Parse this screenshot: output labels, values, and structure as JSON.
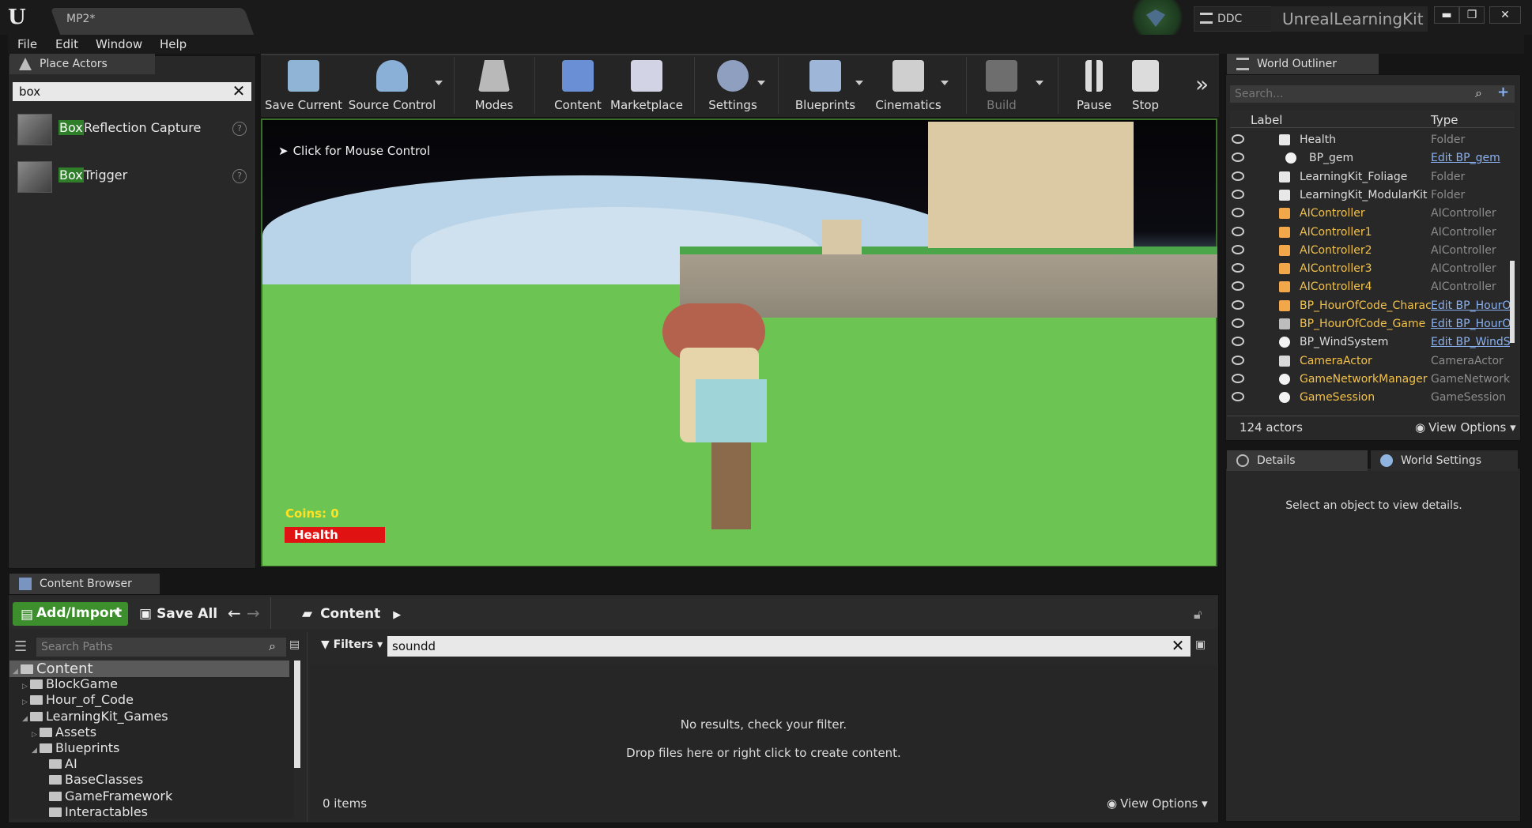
{
  "window": {
    "document_tab": "MP2*",
    "ddc_label": "DDC",
    "project_name": "UnrealLearningKit",
    "min_glyph": "▬",
    "restore_glyph": "❐",
    "close_glyph": "✕"
  },
  "menu": [
    "File",
    "Edit",
    "Window",
    "Help"
  ],
  "place_actors": {
    "tab": "Place Actors",
    "search_value": "box",
    "items": [
      {
        "highlight": "Box",
        "rest": " Reflection Capture"
      },
      {
        "highlight": "Box",
        "rest": " Trigger"
      }
    ]
  },
  "toolbar": {
    "buttons": [
      "Save Current",
      "Source Control",
      "Modes",
      "Content",
      "Marketplace",
      "Settings",
      "Blueprints",
      "Cinematics",
      "Build",
      "Pause",
      "Stop"
    ],
    "more_glyph": "»"
  },
  "viewport": {
    "hint": "Click for Mouse Control",
    "coins": "Coins: 0",
    "health": "Health"
  },
  "world_outliner": {
    "tab": "World Outliner",
    "search_placeholder": "Search...",
    "col_label": "Label",
    "col_type": "Type",
    "rows": [
      {
        "name": "Health",
        "type": "Folder",
        "kind": "folder",
        "link": false
      },
      {
        "name": "BP_gem",
        "type": "Edit BP_gem",
        "kind": "ball",
        "link": true
      },
      {
        "name": "LearningKit_Foliage",
        "type": "Folder",
        "kind": "folder",
        "link": false
      },
      {
        "name": "LearningKit_ModularKit",
        "type": "Folder",
        "kind": "folder",
        "link": false
      },
      {
        "name": "AIController",
        "type": "AIController",
        "kind": "ai",
        "link": false
      },
      {
        "name": "AIController1",
        "type": "AIController",
        "kind": "ai",
        "link": false
      },
      {
        "name": "AIController2",
        "type": "AIController",
        "kind": "ai",
        "link": false
      },
      {
        "name": "AIController3",
        "type": "AIController",
        "kind": "ai",
        "link": false
      },
      {
        "name": "AIController4",
        "type": "AIController",
        "kind": "ai",
        "link": false
      },
      {
        "name": "BP_HourOfCode_Character",
        "type": "Edit BP_HourOfCode",
        "kind": "ai",
        "link": true
      },
      {
        "name": "BP_HourOfCode_Game",
        "type": "Edit BP_HourOfCode",
        "kind": "game",
        "link": true
      },
      {
        "name": "BP_WindSystem",
        "type": "Edit BP_WindSystem",
        "kind": "ball",
        "link": true
      },
      {
        "name": "CameraActor",
        "type": "CameraActor",
        "kind": "camera",
        "link": false
      },
      {
        "name": "GameNetworkManager",
        "type": "GameNetworkManager",
        "kind": "ball",
        "link": false
      },
      {
        "name": "GameSession",
        "type": "GameSession",
        "kind": "ball",
        "link": false
      }
    ],
    "actor_count": "124 actors",
    "view_options": "View Options"
  },
  "details": {
    "tab": "Details",
    "tab2": "World Settings",
    "message": "Select an object to view details."
  },
  "content_browser": {
    "tab": "Content Browser",
    "add_import": "Add/Import",
    "save_all": "Save All",
    "path": "Content",
    "search_paths_placeholder": "Search Paths",
    "filters": "Filters",
    "filter_value": "soundd",
    "tree": [
      {
        "label": "Content",
        "depth": 0,
        "tri": "◢"
      },
      {
        "label": "BlockGame",
        "depth": 1,
        "tri": "▷"
      },
      {
        "label": "Hour_of_Code",
        "depth": 1,
        "tri": "▷"
      },
      {
        "label": "LearningKit_Games",
        "depth": 1,
        "tri": "◢"
      },
      {
        "label": "Assets",
        "depth": 2,
        "tri": "▷"
      },
      {
        "label": "Blueprints",
        "depth": 2,
        "tri": "◢"
      },
      {
        "label": "AI",
        "depth": 3,
        "tri": ""
      },
      {
        "label": "BaseClasses",
        "depth": 3,
        "tri": ""
      },
      {
        "label": "GameFramework",
        "depth": 3,
        "tri": ""
      },
      {
        "label": "Interactables",
        "depth": 3,
        "tri": ""
      }
    ],
    "no_results": "No results, check your filter.",
    "drop_hint": "Drop files here or right click to create content.",
    "items_count": "0 items",
    "view_options": "View Options"
  },
  "colors": {
    "accent_green": "#3c8f2c",
    "highlight_green": "#2f7f2a",
    "actor_yellow": "#f2c14a",
    "link_blue": "#8ab2f0",
    "health_red": "#e01212",
    "coins_yellow": "#ffe224"
  }
}
